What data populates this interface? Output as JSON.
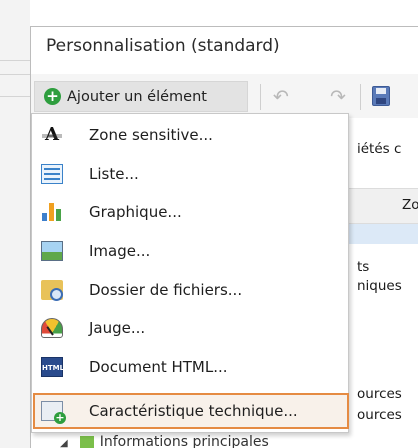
{
  "window": {
    "title": "Personnalisation (standard)"
  },
  "toolbar": {
    "add_button_label": "Ajouter un élément",
    "undo_icon": "undo-icon",
    "redo_icon": "redo-icon",
    "save_icon": "save-icon"
  },
  "menu": {
    "items": [
      {
        "label": "Zone sensitive...",
        "icon": "text-zone-icon"
      },
      {
        "label": "Liste...",
        "icon": "list-icon"
      },
      {
        "label": "Graphique...",
        "icon": "chart-icon"
      },
      {
        "label": "Image...",
        "icon": "image-icon"
      },
      {
        "label": "Dossier de fichiers...",
        "icon": "folder-search-icon"
      },
      {
        "label": "Jauge...",
        "icon": "gauge-icon"
      },
      {
        "label": "Document HTML...",
        "icon": "html-document-icon"
      },
      {
        "label": "Caractéristique technique...",
        "icon": "technical-feature-icon"
      }
    ],
    "highlighted_index": 7
  },
  "background": {
    "tab_fragment": "iétés c",
    "column_fragment": "Zo",
    "line1": "ts",
    "line2": "niques",
    "line3": "ources",
    "line4": "ources",
    "tree_row": "Informations principales"
  },
  "colors": {
    "highlight_border": "#e58b43",
    "add_icon_green": "#2e9e3e"
  }
}
